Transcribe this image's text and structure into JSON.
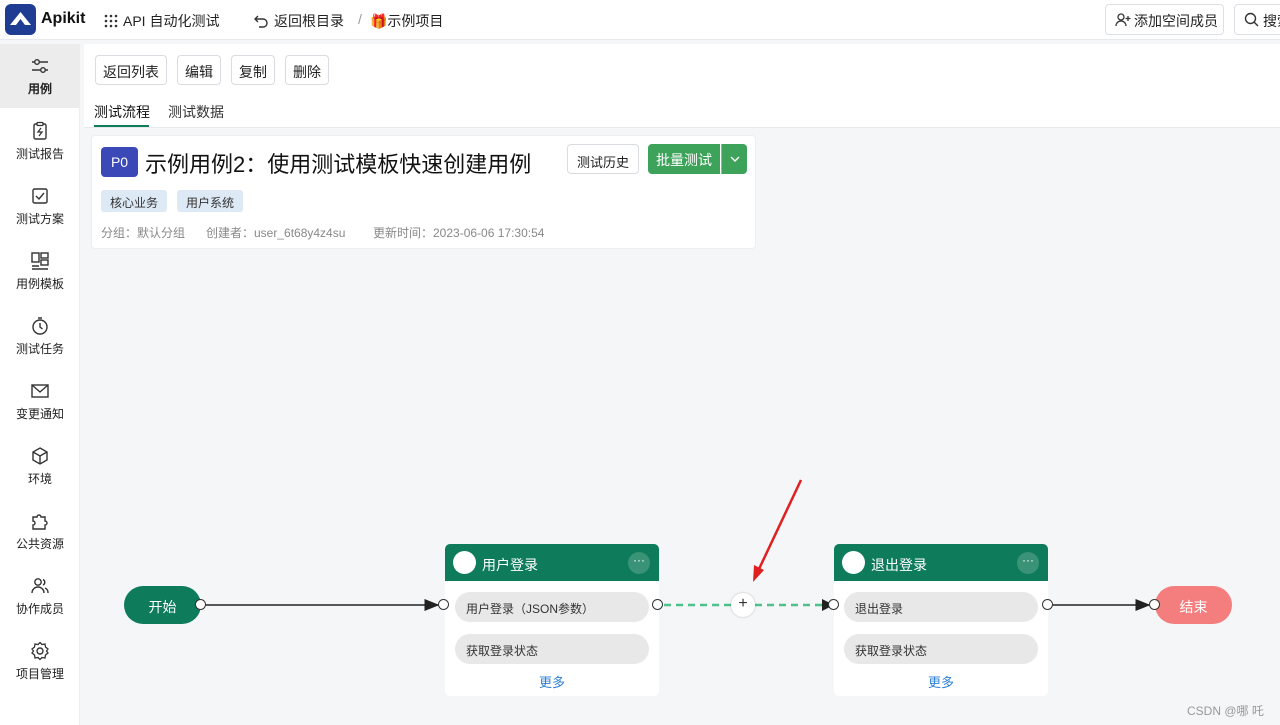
{
  "header": {
    "app_name": "Apikit",
    "module": "API 自动化测试",
    "back_root": "返回根目录",
    "breadcrumb_sep": "/",
    "project": "🎁示例项目",
    "add_member": "添加空间成员",
    "search": "搜索"
  },
  "sidebar": {
    "items": [
      {
        "label": "用例",
        "icon": "sliders-icon"
      },
      {
        "label": "测试报告",
        "icon": "report-icon"
      },
      {
        "label": "测试方案",
        "icon": "checklist-icon"
      },
      {
        "label": "用例模板",
        "icon": "template-icon"
      },
      {
        "label": "测试任务",
        "icon": "timer-icon"
      },
      {
        "label": "变更通知",
        "icon": "mail-icon"
      },
      {
        "label": "环境",
        "icon": "cube-icon"
      },
      {
        "label": "公共资源",
        "icon": "puzzle-icon"
      },
      {
        "label": "协作成员",
        "icon": "users-icon"
      },
      {
        "label": "项目管理",
        "icon": "gear-icon"
      }
    ]
  },
  "toolbar": {
    "back_list": "返回列表",
    "edit": "编辑",
    "copy": "复制",
    "delete": "删除"
  },
  "tabs": [
    "测试流程",
    "测试数据"
  ],
  "case": {
    "priority": "P0",
    "title": "示例用例2：使用测试模板快速创建用例",
    "history_button": "测试历史",
    "batch_button": "批量测试",
    "tags": [
      "核心业务",
      "用户系统"
    ],
    "group": "分组：默认分组",
    "creator": "创建者：user_6t68y4z4su",
    "updated": "更新时间：2023-06-06 17:30:54"
  },
  "flow": {
    "start": "开始",
    "end": "结束",
    "steps": [
      {
        "title": "用户登录",
        "apis": [
          "用户登录（JSON参数）",
          "获取登录状态"
        ],
        "more": "更多"
      },
      {
        "title": "退出登录",
        "apis": [
          "退出登录",
          "获取登录状态"
        ],
        "more": "更多"
      }
    ],
    "add_symbol": "+"
  },
  "watermark": "CSDN @哪 吒",
  "colors": {
    "brand": "#1f3c93",
    "primary_green": "#0e7b5a",
    "batch_green": "#3da25a",
    "end_red": "#f47e7e",
    "link_blue": "#2c7fd6",
    "annotation_arrow": "#e02020"
  }
}
